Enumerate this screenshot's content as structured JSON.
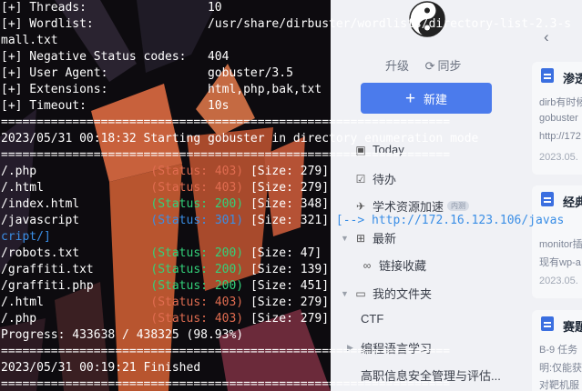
{
  "app": {
    "upgrade_label": "升级",
    "sync_label": "同步",
    "new_button_label": "新建",
    "nav": [
      {
        "label": "Today",
        "icon": "calendar-icon"
      },
      {
        "label": "待办",
        "icon": "checkbox-icon"
      },
      {
        "label": "学术资源加速",
        "icon": "rocket-icon",
        "badge": "内测"
      },
      {
        "label": "最新",
        "icon": "grid-icon"
      },
      {
        "label": "链接收藏",
        "icon": "link-icon"
      },
      {
        "label": "我的文件夹",
        "icon": "folder-icon"
      },
      {
        "label": "CTF",
        "icon": ""
      },
      {
        "label": "编程语言学习",
        "icon": ""
      },
      {
        "label": "高职信息安全管理与评估...",
        "icon": ""
      }
    ],
    "cards": [
      {
        "title": "渗透",
        "lines": [
          "dirb有时候",
          "gobuster",
          "http://172"
        ],
        "date": "2023.05."
      },
      {
        "title": "经典",
        "lines": [
          "",
          "monitor插",
          "现有wp-a"
        ],
        "date": "2023.05."
      },
      {
        "title": "赛题",
        "lines": [
          "B-9 任务",
          "明:仅能获",
          "对靶机服"
        ],
        "date": ""
      }
    ],
    "accent_color": "#4b7bec"
  },
  "terminal": {
    "lines": [
      [
        {
          "t": "[+] Threads:                 10",
          "c": ""
        }
      ],
      [
        {
          "t": "[+] Wordlist:                /usr/share/dirbuster/wordlists/directory-list-2.3-s",
          "c": ""
        }
      ],
      [
        {
          "t": "mall.txt",
          "c": ""
        }
      ],
      [
        {
          "t": "[+] Negative Status codes:   404",
          "c": ""
        }
      ],
      [
        {
          "t": "[+] User Agent:              gobuster/3.5",
          "c": ""
        }
      ],
      [
        {
          "t": "[+] Extensions:              html,php,bak,txt",
          "c": ""
        }
      ],
      [
        {
          "t": "[+] Timeout:                 10s",
          "c": ""
        }
      ],
      [
        {
          "t": "===============================================================",
          "c": ""
        }
      ],
      [
        {
          "t": "2023/05/31 00:18:32 Starting gobuster in directory enumeration mode",
          "c": ""
        }
      ],
      [
        {
          "t": "===============================================================",
          "c": ""
        }
      ],
      [
        {
          "t": "/.php                ",
          "c": ""
        },
        {
          "t": "(Status: 403)",
          "c": "c-red"
        },
        {
          "t": " [Size: 279]",
          "c": ""
        }
      ],
      [
        {
          "t": "/.html               ",
          "c": ""
        },
        {
          "t": "(Status: 403)",
          "c": "c-red"
        },
        {
          "t": " [Size: 279]",
          "c": ""
        }
      ],
      [
        {
          "t": "/index.html          ",
          "c": ""
        },
        {
          "t": "(Status: 200)",
          "c": "c-green"
        },
        {
          "t": " [Size: 348]",
          "c": ""
        }
      ],
      [
        {
          "t": "/javascript          ",
          "c": ""
        },
        {
          "t": "(Status: 301)",
          "c": "c-blue"
        },
        {
          "t": " [Size: 321]",
          "c": ""
        },
        {
          "t": " [--> http://172.16.123.106/javas",
          "c": "c-blue"
        }
      ],
      [
        {
          "t": "cript/]",
          "c": "c-blue"
        }
      ],
      [
        {
          "t": "/robots.txt          ",
          "c": ""
        },
        {
          "t": "(Status: 200)",
          "c": "c-green"
        },
        {
          "t": " [Size: 47]",
          "c": ""
        }
      ],
      [
        {
          "t": "/graffiti.txt        ",
          "c": ""
        },
        {
          "t": "(Status: 200)",
          "c": "c-green"
        },
        {
          "t": " [Size: 139]",
          "c": ""
        }
      ],
      [
        {
          "t": "/graffiti.php        ",
          "c": ""
        },
        {
          "t": "(Status: 200)",
          "c": "c-green"
        },
        {
          "t": " [Size: 451]",
          "c": ""
        }
      ],
      [
        {
          "t": "/.html               ",
          "c": ""
        },
        {
          "t": "(Status: 403)",
          "c": "c-red"
        },
        {
          "t": " [Size: 279]",
          "c": ""
        }
      ],
      [
        {
          "t": "/.php                ",
          "c": ""
        },
        {
          "t": "(Status: 403)",
          "c": "c-red"
        },
        {
          "t": " [Size: 279]",
          "c": ""
        }
      ],
      [
        {
          "t": "Progress: 433638 / 438325 (98.93%)",
          "c": ""
        }
      ],
      [
        {
          "t": "===============================================================",
          "c": ""
        }
      ],
      [
        {
          "t": "2023/05/31 00:19:21 Finished",
          "c": ""
        }
      ],
      [
        {
          "t": "===============================================================",
          "c": ""
        }
      ]
    ]
  }
}
